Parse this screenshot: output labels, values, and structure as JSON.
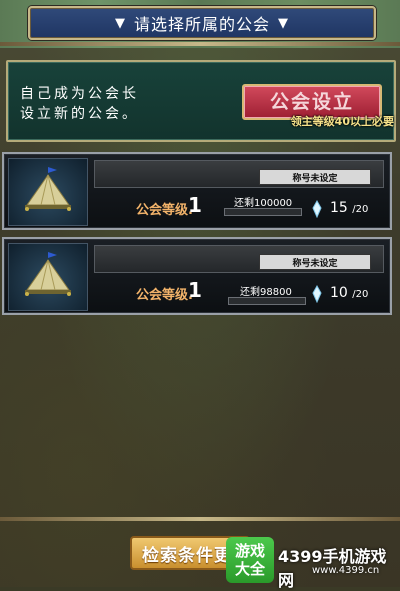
{
  "header": {
    "title": "请选择所属的公会",
    "left_arrow": "▼",
    "right_arrow": "▼"
  },
  "create": {
    "line1": "自己成为公会长",
    "line2": "设立新的公会。",
    "button_label": "公会设立",
    "requirement": "领主等级40以上必要"
  },
  "guilds": [
    {
      "title_tag": "称号未设定",
      "level_label": "公会等级.",
      "level": "1",
      "remain_label": "还剩",
      "remain_value": "100000",
      "members": "15",
      "capacity": "/20"
    },
    {
      "title_tag": "称号未设定",
      "level_label": "公会等级.",
      "level": "1",
      "remain_label": "还剩",
      "remain_value": "98800",
      "members": "10",
      "capacity": "/20"
    }
  ],
  "search_button": "检索条件更",
  "watermark": {
    "badge_line1": "游戏",
    "badge_line2": "大全",
    "text": "4399手机游戏网",
    "url": "www.4399.cn"
  },
  "colors": {
    "header_bg": "#1f3563",
    "create_button": "#b8283c",
    "panel": "#12332d"
  },
  "icons": [
    "tent-emblem-icon",
    "member-icon"
  ]
}
